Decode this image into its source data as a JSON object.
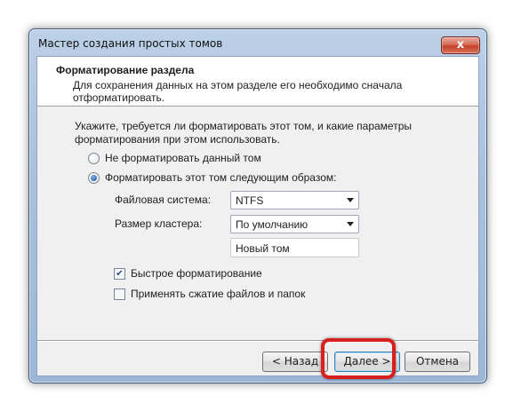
{
  "window": {
    "title": "Мастер создания простых томов",
    "close_label": "x"
  },
  "header": {
    "title": "Форматирование раздела",
    "subtitle": "Для сохранения данных на этом разделе его необходимо сначала отформатировать."
  },
  "content": {
    "instruction": "Укажите, требуется ли форматировать этот том, и какие параметры форматирования при этом использовать.",
    "radio_no_format": "Не форматировать данный том",
    "radio_format": "Форматировать этот том следующим образом:",
    "fs_label": "Файловая система:",
    "fs_value": "NTFS",
    "cluster_label": "Размер кластера:",
    "cluster_value": "По умолчанию",
    "volume_label_value": "Новый том",
    "quick_format": "Быстрое форматирование",
    "compression": "Применять сжатие файлов и папок"
  },
  "buttons": {
    "back": "< Назад",
    "next": "Далее >",
    "cancel": "Отмена"
  },
  "colors": {
    "highlight": "#d9201f"
  }
}
